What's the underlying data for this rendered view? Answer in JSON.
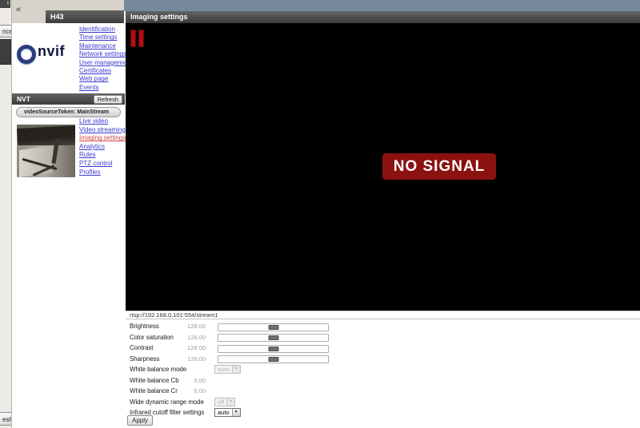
{
  "colors": {
    "header_bar": "#454545",
    "top_strip_blue_gray": "#76889b",
    "link_blue": "#3a3ad2",
    "active_link_red": "#d04545",
    "no_signal_bg": "#8c1111",
    "pause_red": "#b11010",
    "panel_gray": "#d6d3cb"
  },
  "left_window": {
    "tab_label": "t",
    "cancel_button_partial": "ncel",
    "refresh_button_partial": "esh"
  },
  "sidebar": {
    "collapse_icon": "«",
    "title": "H43",
    "logo_text": "nvif",
    "device_links": [
      "Identification",
      "Time settings",
      "Maintenance",
      "Network settings",
      "User management",
      "Certificates",
      "Web page",
      "Events"
    ],
    "nvt": {
      "title": "NVT",
      "refresh_label": "Refresh",
      "source_token": "videoSourceToken: MainStream",
      "links": [
        {
          "label": "Live video",
          "active": false
        },
        {
          "label": "Video streaming",
          "active": false
        },
        {
          "label": "Imaging settings",
          "active": true
        },
        {
          "label": "Analytics",
          "active": false
        },
        {
          "label": "Rules",
          "active": false
        },
        {
          "label": "PTZ control",
          "active": false
        },
        {
          "label": "Profiles",
          "active": false
        }
      ]
    }
  },
  "main": {
    "title": "Imaging settings",
    "video": {
      "no_signal": "NO SIGNAL"
    },
    "stream_url": "rtsp://192.168.0.101:554/stream1",
    "settings": [
      {
        "label": "Brightness",
        "value": "128.00",
        "control": "slider"
      },
      {
        "label": "Color saturation",
        "value": "128.00",
        "control": "slider"
      },
      {
        "label": "Contrast",
        "value": "128.00",
        "control": "slider"
      },
      {
        "label": "Sharpness",
        "value": "128.00",
        "control": "slider"
      },
      {
        "label": "White balance mode",
        "value": "auto",
        "control": "select",
        "enabled": false
      },
      {
        "label": "White balance Cb",
        "value": "0,00",
        "control": "text"
      },
      {
        "label": "White balance Cr",
        "value": "0,00",
        "control": "text"
      },
      {
        "label": "Wide dynamic range mode",
        "value": "off",
        "control": "select",
        "enabled": false
      },
      {
        "label": "Infrared cutoff filter settings",
        "value": "auto",
        "control": "select",
        "enabled": true
      }
    ],
    "apply_label": "Apply"
  }
}
